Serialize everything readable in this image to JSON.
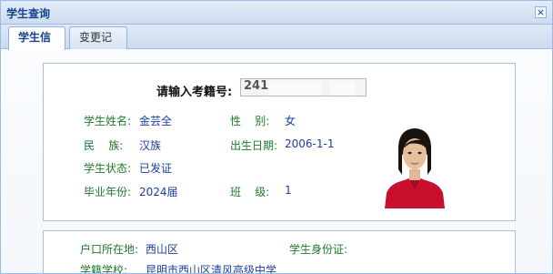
{
  "window": {
    "title": "学生查询",
    "close_icon": "close-icon"
  },
  "tabs": [
    {
      "label": "学生信息",
      "active": true
    },
    {
      "label": "变更记录",
      "active": false
    }
  ],
  "search": {
    "label": "请输入考籍号:",
    "value": "241"
  },
  "student": {
    "name_label": "学生姓名:",
    "name_value": "金芸全",
    "gender_label": "性    别:",
    "gender_value": "女",
    "ethnicity_label": "民    族:",
    "ethnicity_value": "汉族",
    "birth_label": "出生日期:",
    "birth_value": "2006-1-1",
    "status_label": "学生状态:",
    "status_value": "已发证",
    "grad_label": "毕业年份:",
    "grad_value": "2024届",
    "class_label": "班    级:",
    "class_value": "1"
  },
  "residence": {
    "hukou_label": "户口所在地:",
    "hukou_value": "西山区",
    "id_label": "学生身份证:",
    "id_value": "",
    "school_label": "学籍学校:",
    "school_value": "昆明市西山区清风高级中学"
  },
  "colors": {
    "label": "#1e7a2c",
    "value": "#1b3fa0",
    "border": "#99bbe8",
    "photo_bg": "#ffffff",
    "shirt": "#c8102e"
  }
}
